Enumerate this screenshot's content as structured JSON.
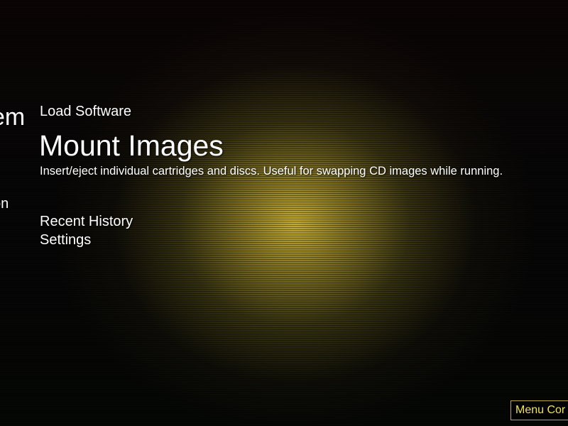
{
  "sidebar": {
    "partial_items": [
      "em",
      "on"
    ]
  },
  "menu": {
    "items": [
      {
        "label": "Load Software"
      },
      {
        "label": "Mount Images",
        "description": "Insert/eject individual cartridges and discs. Useful for swapping CD images while running."
      },
      {
        "label": "Recent History"
      },
      {
        "label": "Settings"
      }
    ],
    "selected_index": 1
  },
  "footer": {
    "menu_badge_label": "Menu Cor"
  },
  "colors": {
    "glow": "#cdb437",
    "badge_text": "#f0e25a",
    "badge_border": "#b8a640",
    "text": "#ffffff"
  }
}
